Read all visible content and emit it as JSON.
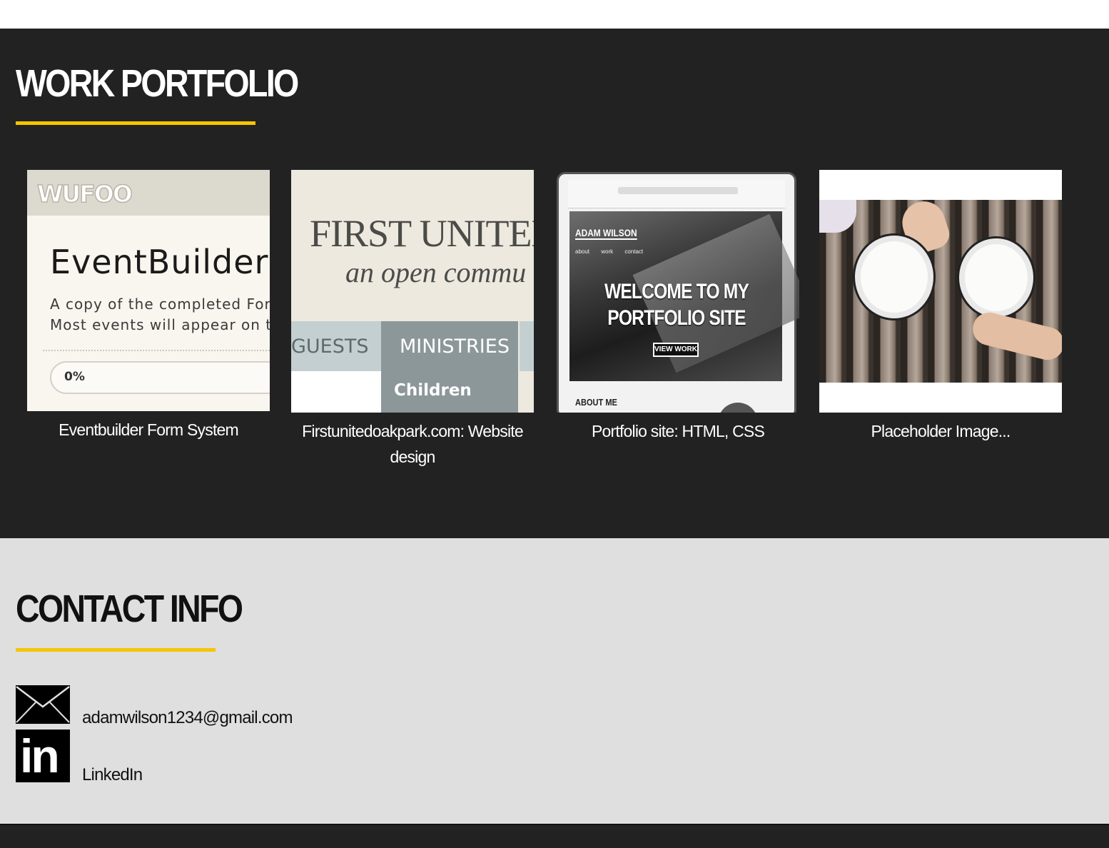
{
  "portfolio": {
    "title": "WORK PORTFOLIO",
    "items": [
      {
        "caption": "Eventbuilder Form System",
        "thumb": {
          "logo": "WUFOO",
          "heading": "EventBuilder",
          "line1": "A copy of the completed Forr",
          "line2": "Most events will appear on th",
          "progress": "0%"
        }
      },
      {
        "caption": "Firstunitedoakpark.com: Website design",
        "thumb": {
          "line1": "FIRST UNITED",
          "line2": "an open commu",
          "nav1": "GUESTS",
          "nav2": "MINISTRIES",
          "sub": "Children"
        }
      },
      {
        "caption": "Portfolio site: HTML, CSS",
        "thumb": {
          "name": "ADAM WILSON",
          "menu": "about work contact",
          "headline": "WELCOME TO MY PORTFOLIO SITE",
          "button": "VIEW WORK",
          "about": "ABOUT ME"
        }
      },
      {
        "caption": "Placeholder Image...",
        "thumb": {}
      }
    ]
  },
  "contact": {
    "title": "CONTACT INFO",
    "email": "adamwilson1234@gmail.com",
    "linkedin": "LinkedIn",
    "linkedin_logo": "in"
  },
  "colors": {
    "dark_bg": "#222222",
    "light_bg": "#dfdfdf",
    "accent": "#f6c500"
  }
}
